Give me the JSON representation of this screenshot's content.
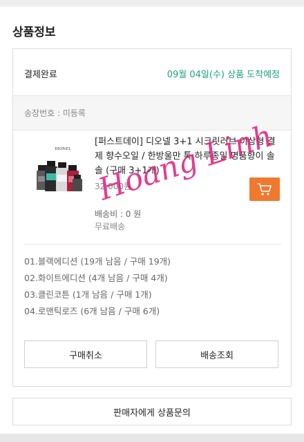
{
  "section": {
    "title": "상품정보"
  },
  "order": {
    "status_label": "결제완료",
    "delivery_estimate": "09월 04일(수) 상품 도착예정",
    "tracking_text": "송장번호 : 미등록"
  },
  "product": {
    "brand_label": "DIONEL",
    "name": "[퍼스트데이] 디오넬 3+1 시크릿러브 이상형 결제 향수오일 / 한방울만 톡 하루종일 명품향이 솔솔 (구매 3+1개)",
    "price": "32,000원",
    "shipping_fee": "배송비 : 0 원",
    "free_shipping": "무료배송",
    "cart_icon": "cart-icon"
  },
  "options": [
    {
      "label": "01.블랙에디션 (19개 남음 / 구매 19개)"
    },
    {
      "label": "02.화이트에디션 (4개 남음 / 구매 4개)"
    },
    {
      "label": "03.클린코튼 (1개 남음 / 구매 1개)"
    },
    {
      "label": "04.로맨틱로즈 (6개 남음 / 구매 6개)"
    }
  ],
  "actions": {
    "cancel_label": "구매취소",
    "track_label": "배송조회",
    "inquiry_label": "판매자에게 상품문의"
  },
  "watermark": {
    "text": "Hoang Linh"
  },
  "colors": {
    "accent_green": "#1aa37a",
    "cart_orange": "#f0792e",
    "watermark_pink": "#e2197a"
  }
}
